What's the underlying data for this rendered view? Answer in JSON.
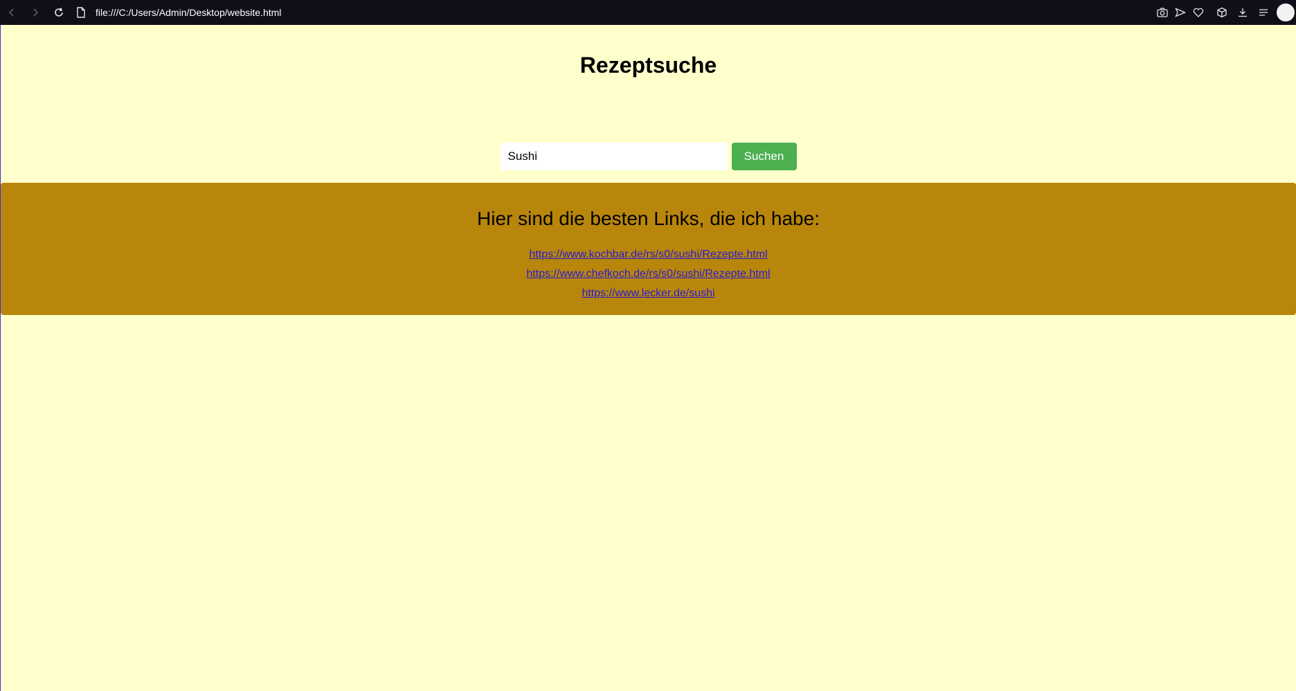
{
  "browser": {
    "url": "file:///C:/Users/Admin/Desktop/website.html",
    "toolbar_icons": [
      "camera-icon",
      "send-icon",
      "heart-icon",
      "box-icon",
      "download-icon",
      "menu-icon"
    ]
  },
  "page": {
    "title": "Rezeptsuche",
    "search": {
      "value": "Sushi",
      "button_label": "Suchen"
    },
    "results": {
      "heading": "Hier sind die besten Links, die ich habe:",
      "links": [
        "https://www.kochbar.de/rs/s0/sushi/Rezepte.html",
        "https://www.chefkoch.de/rs/s0/sushi/Rezepte.html",
        "https://www.lecker.de/sushi"
      ]
    }
  },
  "colors": {
    "page_background": "#ffffcc",
    "results_background": "#b8860b",
    "button_background": "#4caf50",
    "link": "#2a1ad6",
    "browser_bar": "#0f0f1a"
  }
}
